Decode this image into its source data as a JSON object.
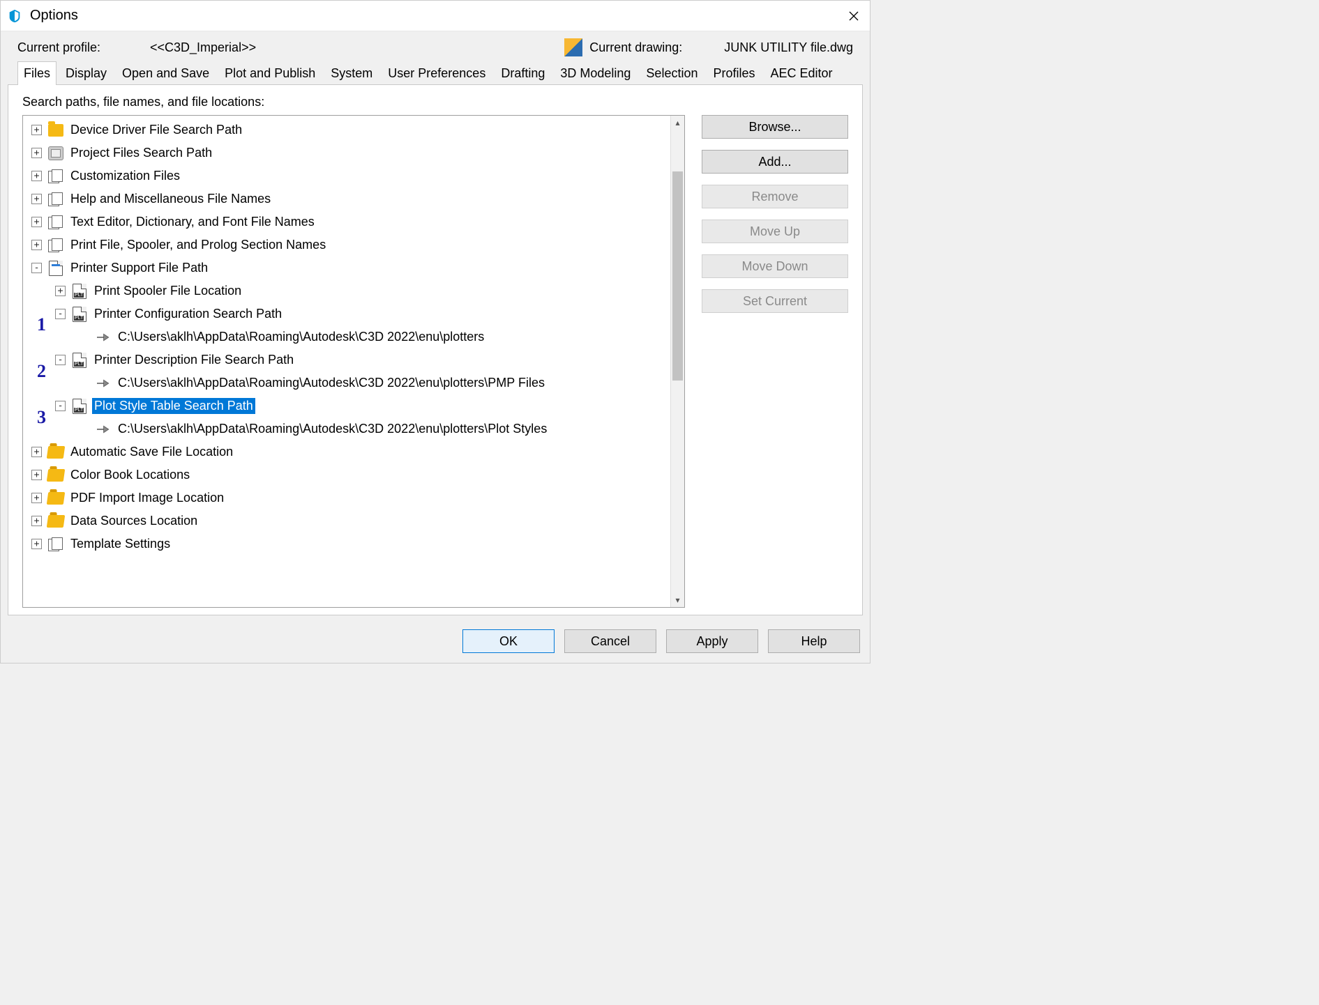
{
  "window": {
    "title": "Options"
  },
  "header": {
    "profile_label": "Current profile:",
    "profile_value": "<<C3D_Imperial>>",
    "drawing_label": "Current drawing:",
    "drawing_value": "JUNK UTILITY file.dwg"
  },
  "tabs": [
    "Files",
    "Display",
    "Open and Save",
    "Plot and Publish",
    "System",
    "User Preferences",
    "Drafting",
    "3D Modeling",
    "Selection",
    "Profiles",
    "AEC Editor"
  ],
  "active_tab": 0,
  "section_label": "Search paths, file names, and file locations:",
  "tree": {
    "items": [
      {
        "label": "Device Driver File Search Path",
        "icon": "folder",
        "exp": "+"
      },
      {
        "label": "Project Files Search Path",
        "icon": "db",
        "exp": "+"
      },
      {
        "label": "Customization Files",
        "icon": "stack",
        "exp": "+"
      },
      {
        "label": "Help and Miscellaneous File Names",
        "icon": "stack",
        "exp": "+"
      },
      {
        "label": "Text Editor, Dictionary, and Font File Names",
        "icon": "stack",
        "exp": "+"
      },
      {
        "label": "Print File, Spooler, and Prolog Section Names",
        "icon": "stack",
        "exp": "+"
      },
      {
        "label": "Printer Support File Path",
        "icon": "file-blue",
        "exp": "-"
      },
      {
        "label": "Print Spooler File Location",
        "icon": "file-plt",
        "exp": "+",
        "depth": 1
      },
      {
        "label": "Printer Configuration Search Path",
        "icon": "file-plt",
        "exp": "-",
        "depth": 1
      },
      {
        "label": "C:\\Users\\aklh\\AppData\\Roaming\\Autodesk\\C3D 2022\\enu\\plotters",
        "icon": "arrow",
        "depth": 2,
        "leaf": true
      },
      {
        "label": "Printer Description File Search Path",
        "icon": "file-plt",
        "exp": "-",
        "depth": 1
      },
      {
        "label": "C:\\Users\\aklh\\AppData\\Roaming\\Autodesk\\C3D 2022\\enu\\plotters\\PMP Files",
        "icon": "arrow",
        "depth": 2,
        "leaf": true
      },
      {
        "label": "Plot Style Table Search Path",
        "icon": "file-plt",
        "exp": "-",
        "depth": 1,
        "selected": true
      },
      {
        "label": "C:\\Users\\aklh\\AppData\\Roaming\\Autodesk\\C3D 2022\\enu\\plotters\\Plot Styles",
        "icon": "arrow",
        "depth": 2,
        "leaf": true
      },
      {
        "label": "Automatic Save File Location",
        "icon": "folder-open",
        "exp": "+"
      },
      {
        "label": "Color Book Locations",
        "icon": "folder-open",
        "exp": "+"
      },
      {
        "label": "PDF Import Image Location",
        "icon": "folder-open",
        "exp": "+"
      },
      {
        "label": "Data Sources Location",
        "icon": "folder-open",
        "exp": "+"
      },
      {
        "label": "Template Settings",
        "icon": "stack",
        "exp": "+"
      }
    ]
  },
  "side_buttons": {
    "browse": "Browse...",
    "add": "Add...",
    "remove": "Remove",
    "moveup": "Move Up",
    "movedown": "Move Down",
    "setcurrent": "Set Current"
  },
  "bottom_buttons": {
    "ok": "OK",
    "cancel": "Cancel",
    "apply": "Apply",
    "help": "Help"
  },
  "annotations": [
    "1",
    "2",
    "3"
  ]
}
